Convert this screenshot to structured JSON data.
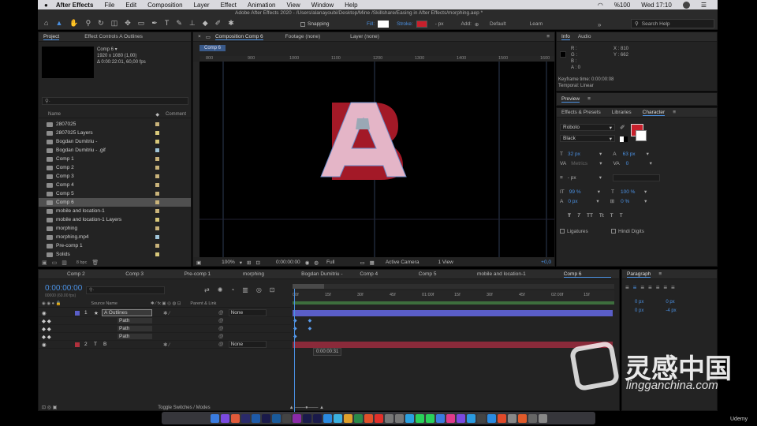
{
  "menubar": {
    "apple": "",
    "app": "After Effects",
    "items": [
      "File",
      "Edit",
      "Composition",
      "Layer",
      "Effect",
      "Animation",
      "View",
      "Window",
      "Help"
    ],
    "battery": "%100",
    "clock": "Wed 17:10"
  },
  "toolbar": {
    "title": "Adobe After Effects 2020 - /Users/alanayoubi/Desktop/Mine /Skillshare/Easing in After Effects/morphing.aep *",
    "snapping": "Snapping",
    "fill": "Fill:",
    "stroke": "Stroke:",
    "stroke_px": "- px",
    "add": "Add:",
    "workspaces": [
      "Default",
      "Learn"
    ],
    "search": "Search Help"
  },
  "project": {
    "tab": "Project",
    "tab2": "Effect Controls A Outlines",
    "comp_name": "Comp 6 ▾",
    "comp_info1": "1920 x 1080 (1,00)",
    "comp_info2": "Δ 0:00:22:01, 60,00 fps",
    "col_name": "Name",
    "col_comment": "Comment",
    "bpc": "8 bpc",
    "items": [
      {
        "name": "2807025",
        "color": "#c9b37a"
      },
      {
        "name": "2807025 Layers",
        "color": "#d8c87a"
      },
      {
        "name": "Bogdan Dumitriu -",
        "color": "#d8c87a"
      },
      {
        "name": "Bogdan Dumitriu - .gif",
        "color": "#9fc4d8"
      },
      {
        "name": "Comp 1",
        "color": "#c9b37a"
      },
      {
        "name": "Comp 2",
        "color": "#c9b37a"
      },
      {
        "name": "Comp 3",
        "color": "#c9b37a"
      },
      {
        "name": "Comp 4",
        "color": "#c9b37a"
      },
      {
        "name": "Comp 5",
        "color": "#c9b37a"
      },
      {
        "name": "Comp 6",
        "color": "#c9b37a"
      },
      {
        "name": "mobile and location-1",
        "color": "#c9b37a"
      },
      {
        "name": "mobile and location-1 Layers",
        "color": "#d8c87a"
      },
      {
        "name": "morphing",
        "color": "#c9b37a"
      },
      {
        "name": "morphing.mp4",
        "color": "#9fc4d8"
      },
      {
        "name": "Pre-comp 1",
        "color": "#c9b37a"
      },
      {
        "name": "Solids",
        "color": "#d8c87a"
      }
    ]
  },
  "viewer": {
    "tab": "Composition Comp 6",
    "tab2": "Footage (none)",
    "tab3": "Layer (none)",
    "breadcrumb": "Comp 6",
    "zoom": "100%",
    "timecode": "0:00:00:00",
    "resolution": "Full",
    "camera": "Active Camera",
    "views": "1 View",
    "exposure": "+0,0",
    "ruler_labels": [
      "800",
      "900",
      "1000",
      "1100",
      "1200",
      "1300",
      "1400",
      "1500",
      "1600"
    ]
  },
  "info": {
    "tab": "Info",
    "tab2": "Audio",
    "r": "R :",
    "g": "G :",
    "b": "B :",
    "a": "A : 0",
    "x": "X : 810",
    "y": "Y : 662",
    "kf_time": "Keyframe time: 0:00:00:08",
    "temporal": "Temporal: Linear"
  },
  "preview": {
    "tab": "Preview"
  },
  "character": {
    "tab1": "Effects & Presets",
    "tab2": "Libraries",
    "tab3": "Character",
    "font": "Roboto",
    "style": "Black",
    "size": "32 px",
    "leading": "63 px",
    "kerning": "Metrics",
    "tracking": "0",
    "stroke": "- px",
    "vscale": "99 %",
    "hscale": "100 %",
    "baseline": "0 px",
    "tsume": "0 %",
    "ligatures": "Ligatures",
    "hindi": "Hindi Digits",
    "text_styles": [
      "T",
      "T",
      "TT",
      "Tt",
      "T",
      "T"
    ],
    "fill_color": "#c8202c"
  },
  "timeline": {
    "timecode": "0:00:00:00",
    "fps": "00000 (60.00 fps)",
    "tabs": [
      "Comp 2",
      "Comp 3",
      "Pre-comp 1",
      "morphing",
      "Bogdan Dumitriu -",
      "Comp 4",
      "Comp 5",
      "mobile and location-1",
      "Comp 6"
    ],
    "col_source": "Source Name",
    "col_parent": "Parent & Link",
    "layers": [
      {
        "num": "1",
        "name": "A Outlines",
        "parent": "None",
        "type": "★"
      },
      {
        "num": "",
        "name": "Path",
        "parent": "",
        "type": ""
      },
      {
        "num": "",
        "name": "Path",
        "parent": "",
        "type": ""
      },
      {
        "num": "",
        "name": "Path",
        "parent": "",
        "type": ""
      },
      {
        "num": "2",
        "name": "B",
        "parent": "None",
        "type": "T"
      }
    ],
    "ruler": [
      "00f",
      "15f",
      "30f",
      "45f",
      "01:00f",
      "15f",
      "30f",
      "45f",
      "02:00f",
      "15f"
    ],
    "tooltip": "0:00:00:31",
    "toggle": "Toggle Switches / Modes"
  },
  "paragraph": {
    "tab": "Paragraph",
    "values": [
      "0 px",
      "0 px",
      "0 px",
      "-4 px",
      "0 px"
    ]
  },
  "watermark": {
    "text": "灵感中国",
    "url": "lingganchina.com",
    "udemy": "Udemy"
  }
}
